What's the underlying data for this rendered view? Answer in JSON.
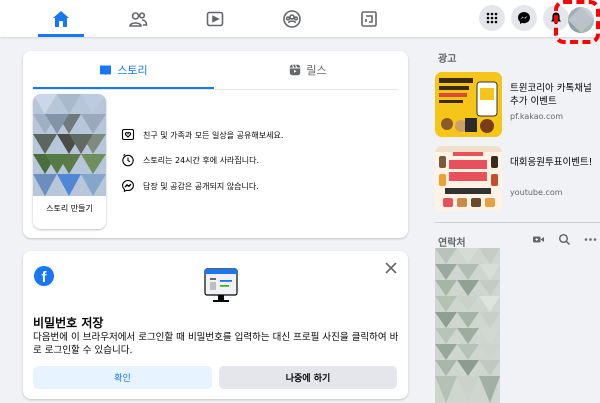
{
  "nav": {
    "tabs": [
      "home",
      "friends",
      "watch",
      "groups",
      "gaming"
    ],
    "active_tab": "home"
  },
  "colors": {
    "accent": "#1877f2",
    "background": "#f0f2f5",
    "highlight": "#ff0000"
  },
  "stories": {
    "tab_stories": "스토리",
    "tab_reels": "릴스",
    "create_label": "스토리 만들기",
    "info": [
      "친구 및 가족과 모든 일상을 공유해보세요.",
      "스토리는 24시간 후에 사라집니다.",
      "답장 및 공감은 공개되지 않습니다."
    ]
  },
  "password_prompt": {
    "title": "비밀번호 저장",
    "description": "다음번에 이 브라우저에서 로그인할 때 비밀번호를 입력하는 대신 프로필 사진을 클릭하여 바로 로그인할 수 있습니다.",
    "confirm_label": "확인",
    "later_label": "나중에 하기"
  },
  "sidebar": {
    "sponsored_heading": "광고",
    "ads": [
      {
        "title": "트윈코리아 카톡채널 추가 이벤트",
        "domain": "pf.kakao.com"
      },
      {
        "title": "대회응원투표이벤트!",
        "domain": "youtube.com"
      }
    ],
    "contacts_heading": "연락처"
  }
}
